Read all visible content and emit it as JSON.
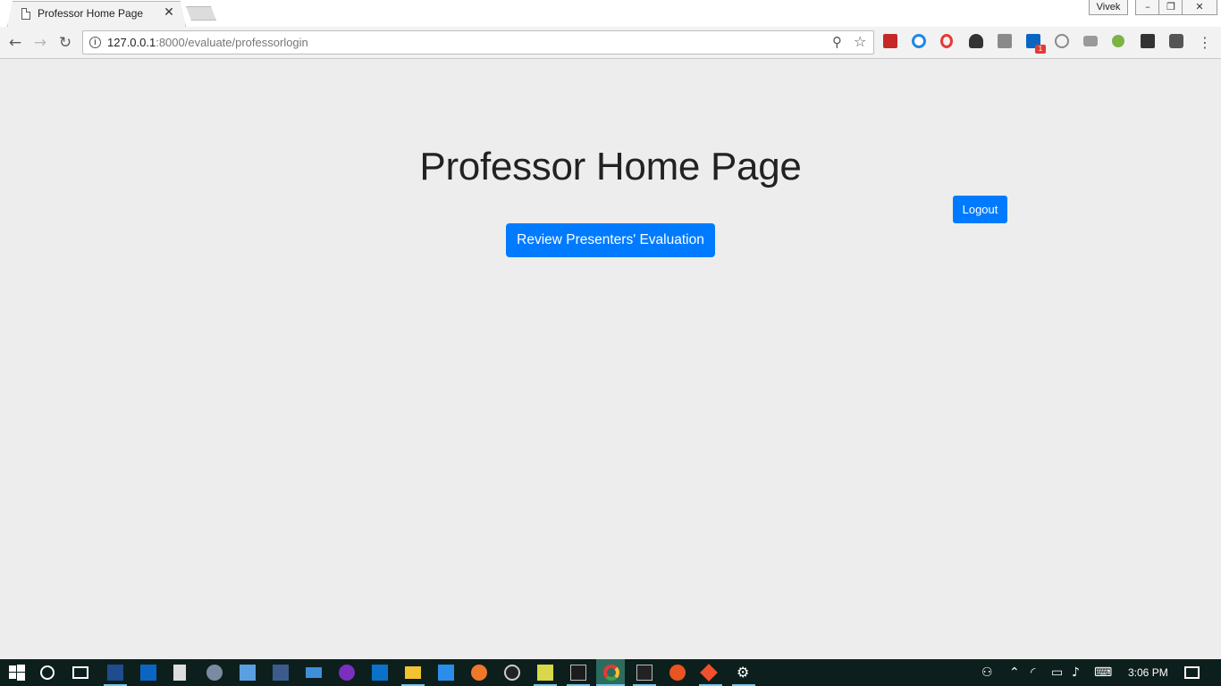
{
  "browser": {
    "tab_title": "Professor Home Page",
    "tab_close": "✕",
    "profile_name": "Vivek",
    "url_host": "127.0.0.1",
    "url_path": ":8000/evaluate/professorlogin",
    "extension_badge": "1"
  },
  "page": {
    "title": "Professor Home Page",
    "logout_label": "Logout",
    "review_label": "Review Presenters' Evaluation"
  },
  "taskbar": {
    "clock": "3:06 PM"
  },
  "colors": {
    "primary": "#007bff",
    "page_background": "#ededed",
    "taskbar": "#0c1f1d"
  }
}
